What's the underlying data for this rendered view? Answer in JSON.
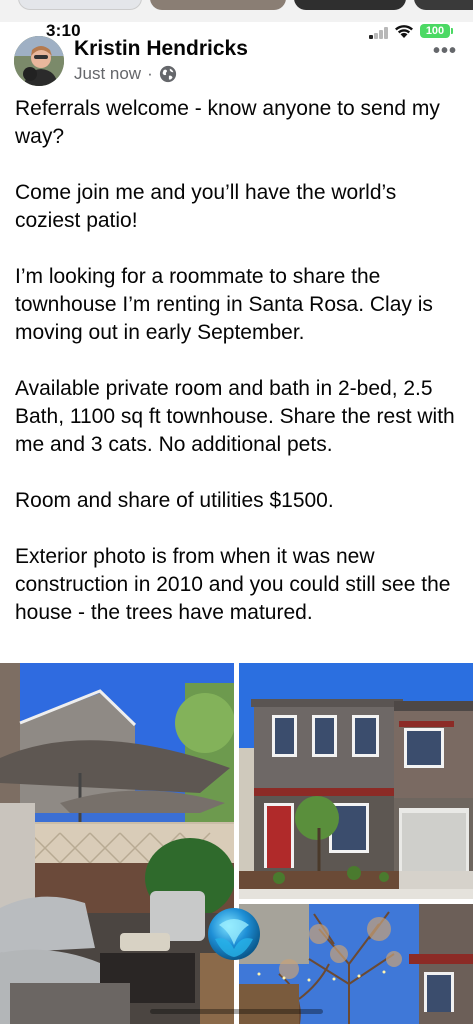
{
  "status_bar": {
    "time": "3:10",
    "battery": "100"
  },
  "post": {
    "author": "Kristin Hendricks",
    "timestamp": "Just now",
    "separator": "·",
    "audience_icon": "globe-icon",
    "more_icon": "more-options-icon",
    "paragraphs": [
      "Referrals welcome - know anyone to send my way?",
      "Come join me and you’ll have the world’s coziest patio!",
      "I’m looking for a roommate to share the townhouse I’m renting in Santa Rosa.  Clay is moving out in early September.",
      "Available private room and bath in 2-bed, 2.5 Bath, 1100 sq ft townhouse.  Share the rest with me and 3 cats.  No additional pets.",
      "Room and share of utilities $1500.",
      "Exterior photo is from when it was new construction in 2010 and you could still see the house - the trees have matured."
    ]
  },
  "photos": [
    {
      "name": "patio-photo"
    },
    {
      "name": "townhouse-exterior-photo"
    },
    {
      "name": "trees-photo"
    }
  ],
  "colors": {
    "text": "#050505",
    "secondary": "#65676b",
    "battery": "#4cd964"
  }
}
